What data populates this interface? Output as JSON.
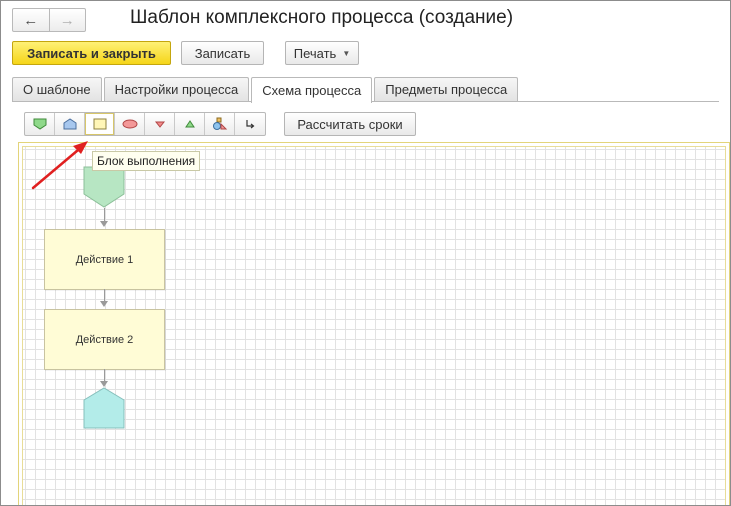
{
  "window": {
    "title": "Шаблон комплексного процесса (создание)",
    "nav": {
      "back_icon": "arrow-left-icon",
      "forward_icon": "arrow-right-icon"
    }
  },
  "commands": {
    "save_close_label": "Записать и закрыть",
    "save_label": "Записать",
    "print_label": "Печать"
  },
  "tabs": [
    {
      "label": "О шаблоне",
      "active": false
    },
    {
      "label": "Настройки процесса",
      "active": false
    },
    {
      "label": "Схема процесса",
      "active": true
    },
    {
      "label": "Предметы процесса",
      "active": false
    }
  ],
  "toolbar": {
    "tools": [
      "start-shape-icon",
      "end-shape-icon",
      "action-block-icon",
      "condition-shape-icon",
      "join-shape-icon",
      "split-shape-icon",
      "subprocess-shape-icon",
      "connector-icon"
    ],
    "calc_label": "Рассчитать сроки",
    "tooltip": "Блок выполнения"
  },
  "diagram": {
    "blocks": [
      {
        "label": "Действие 1"
      },
      {
        "label": "Действие 2"
      }
    ]
  },
  "colors": {
    "primary_button": "#f5d519",
    "start_shape": "#b7e6c3",
    "end_shape": "#b3ece9",
    "action_block": "#fffcd6",
    "annotation_arrow": "#e02020"
  }
}
